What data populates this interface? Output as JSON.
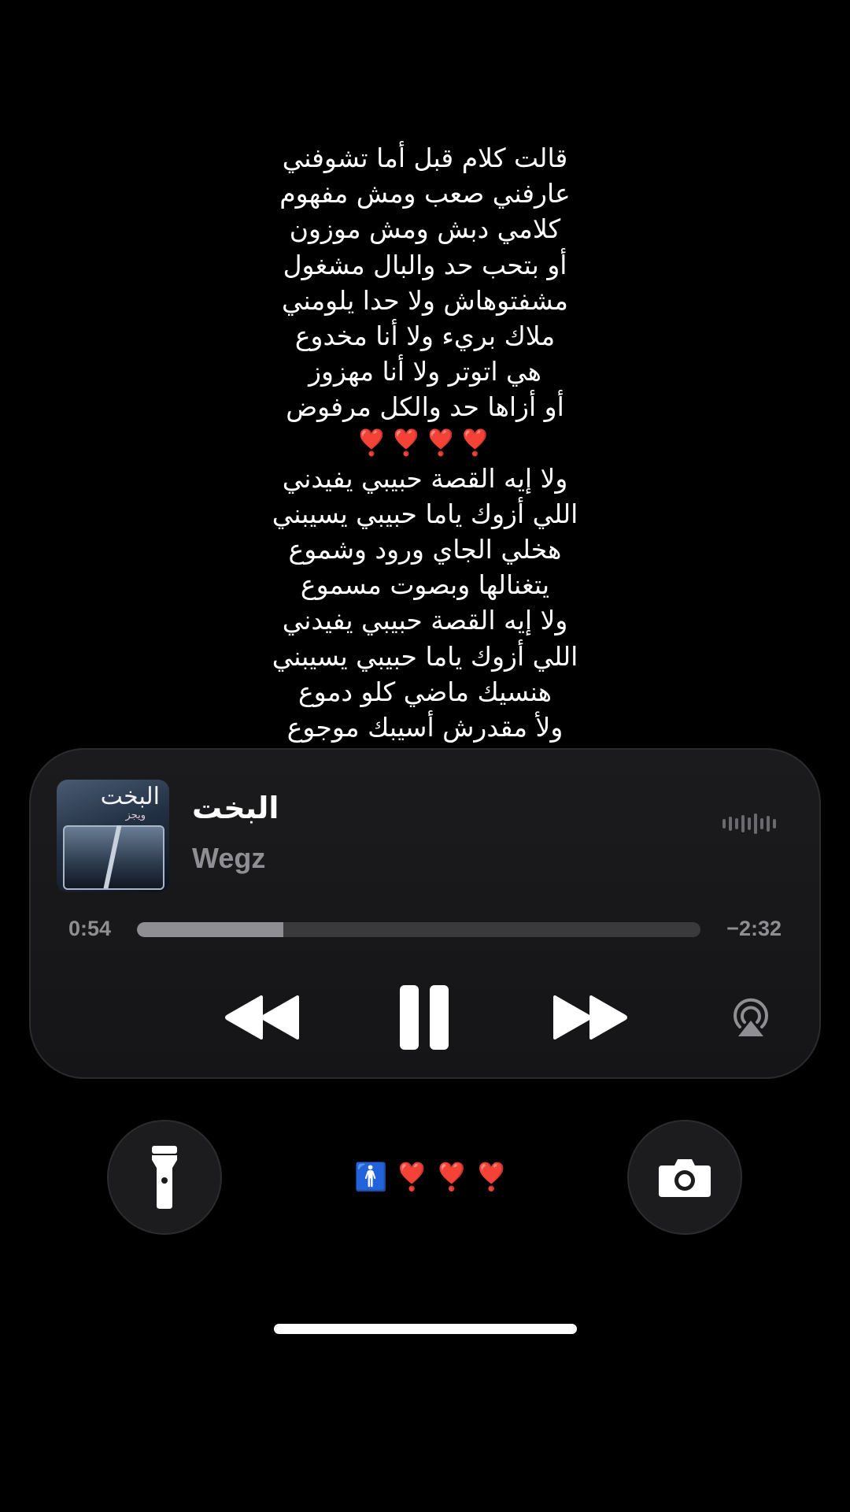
{
  "lyrics": [
    "قالت كلام قبل أما تشوفني",
    "عارفني صعب ومش مفهوم",
    "كلامي دبش ومش موزون",
    "أو بتحب حد والبال مشغول",
    "مشفتوهاش ولا حدا يلومني",
    "ملاك بريء ولا أنا مخدوع",
    "هي اتوتر ولا أنا مهزوز",
    "أو أزاها حد والكل مرفوض",
    "❣️❣️❣️❣️",
    "ولا إيه القصة حبيبي يفيدني",
    "اللي أزوك ياما حبيبي يسيبني",
    "هخلي الجاي ورود وشموع",
    "يتغنالها وبصوت مسموع",
    "ولا إيه القصة حبيبي يفيدني",
    "اللي أزوك ياما حبيبي يسيبني",
    "هنسيك ماضي كلو دموع",
    "ولأ مقدرش أسيبك موجوع"
  ],
  "player": {
    "artwork_title": "البخت",
    "artwork_subtitle": "ويجز",
    "track_title": "البخت",
    "artist": "Wegz",
    "time_elapsed": "0:54",
    "time_remaining": "−2:32",
    "progress_fraction": 0.26,
    "icons": {
      "waveform": "waveform-icon",
      "previous": "rewind-icon",
      "pause": "pause-icon",
      "next": "fast-forward-icon",
      "airplay": "airplay-icon"
    }
  },
  "lockscreen": {
    "flashlight_icon": "flashlight-icon",
    "camera_icon": "camera-icon",
    "status_person": "🚹",
    "status_hearts": "❣️❣️❣️"
  },
  "colors": {
    "background": "#000000",
    "player_bg": "#1b1b1d",
    "secondary_text": "#8e8e93",
    "heart": "#e0102a"
  }
}
